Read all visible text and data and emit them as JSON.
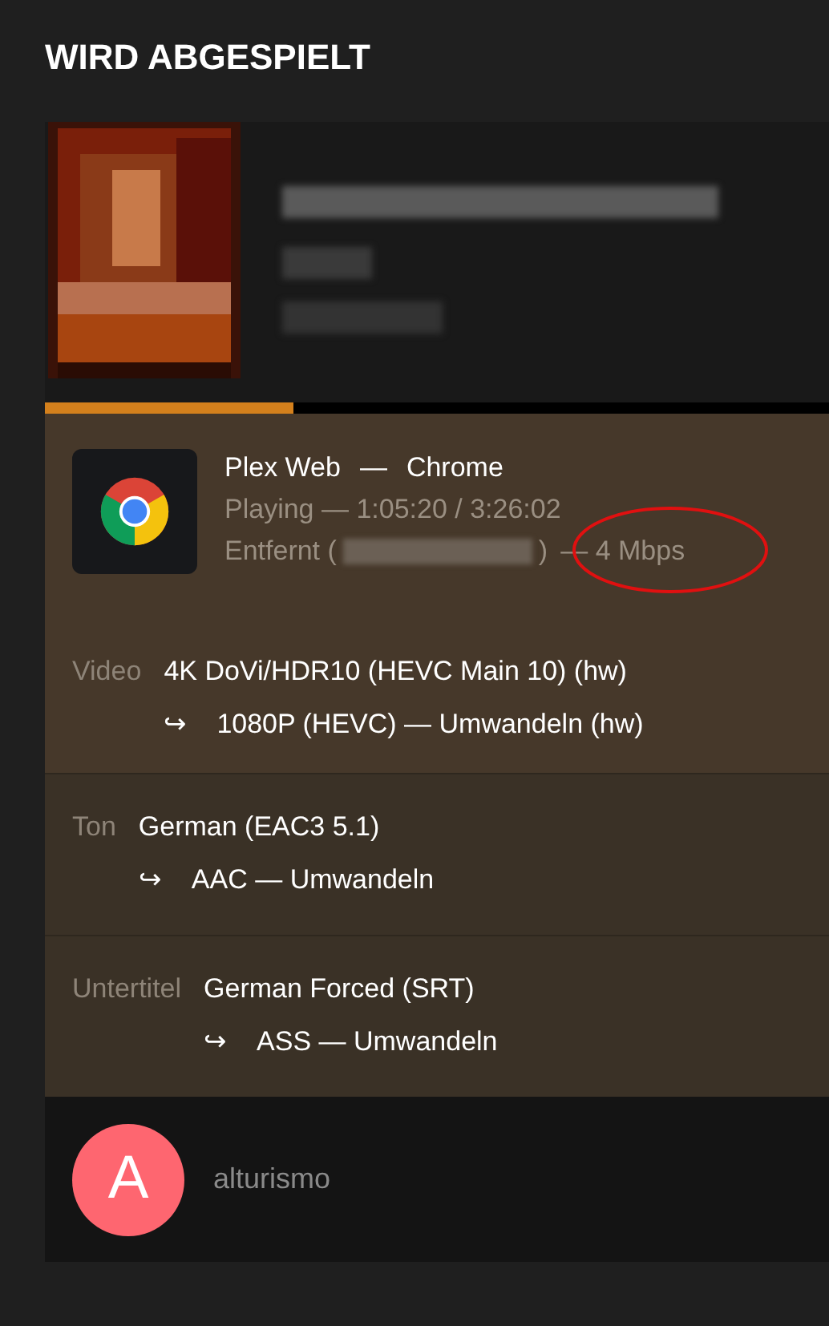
{
  "header": {
    "title": "WIRD ABGESPIELT"
  },
  "session": {
    "progress": {
      "level": 0.317
    },
    "player": {
      "name": "Plex Web",
      "separator": "—",
      "browser": "Chrome",
      "status": "Playing — 1:05:20 / 3:26:02",
      "location_prefix": "Entfernt (",
      "location_suffix": ")",
      "bandwidth": "— 4 Mbps",
      "bandwidth_highlighted": true
    },
    "streams": [
      {
        "label": "Video",
        "source": "4K DoVi/HDR10 (HEVC Main 10) (hw)",
        "arrow": "↪",
        "target": "1080P (HEVC) — Umwandeln (hw)"
      },
      {
        "label": "Ton",
        "source": "German (EAC3 5.1)",
        "arrow": "↪",
        "target": "AAC — Umwandeln"
      },
      {
        "label": "Untertitel",
        "source": "German Forced (SRT)",
        "arrow": "↪",
        "target": "ASS — Umwandeln"
      }
    ]
  },
  "user": {
    "initial": "A",
    "name": "alturismo"
  }
}
